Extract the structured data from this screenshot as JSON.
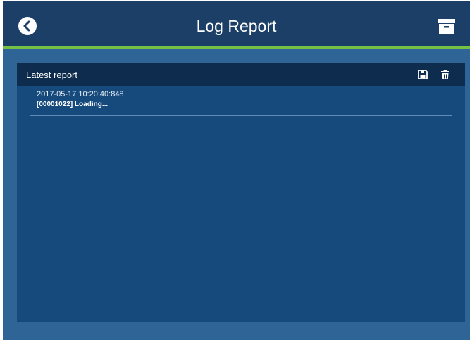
{
  "header": {
    "title": "Log Report",
    "back_icon": "chevron-left-icon",
    "archive_icon": "archive-box-icon"
  },
  "panel": {
    "title": "Latest report",
    "save_icon": "save-icon",
    "delete_icon": "trash-icon"
  },
  "log": {
    "entries": [
      {
        "timestamp": "2017-05-17 10:20:40:848",
        "message": "[00001022] Loading..."
      }
    ]
  },
  "colors": {
    "topbar": "#1b3f66",
    "accent": "#76c043",
    "background": "#2f6496",
    "panel": "#174a7c",
    "panel_header": "#0e2c4d"
  }
}
